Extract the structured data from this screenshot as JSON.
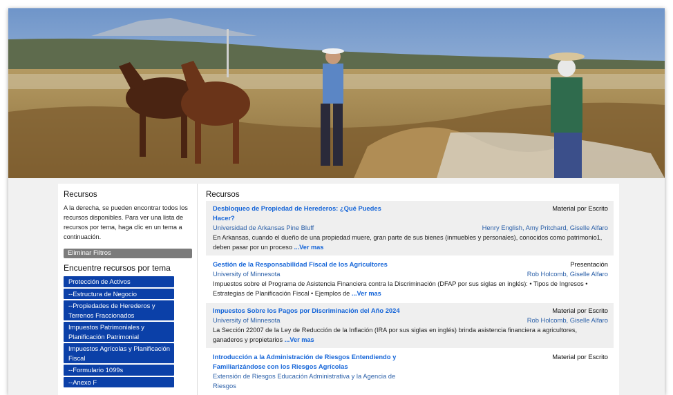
{
  "sidebar": {
    "title": "Recursos",
    "description": "A la derecha, se pueden encontrar todos los recursos disponibles. Para ver una lista de recursos por tema, haga clic en un tema a continuación.",
    "clear_filters_label": "Eliminar Filtros",
    "topics_title": "Encuentre recursos por tema",
    "topics": [
      "Protección de Activos",
      "--Estructura de Negocio",
      "--Propiedades de Herederos y Terrenos Fraccionados",
      "Impuestos Patrimoniales y Planificación Patrimonial",
      "Impuestos Agrícolas y Planificación Fiscal",
      "--Formulario 1099s",
      "--Anexo F"
    ]
  },
  "main": {
    "title": "Recursos",
    "more_label": "...Ver mas",
    "resources": [
      {
        "title": "Desbloqueo de Propiedad de Herederos: ¿Qué Puedes Hacer?",
        "type": "Material por Escrito",
        "institution": "Universidad de Arkansas Pine Bluff",
        "authors": "Henry English, Amy Pritchard, Giselle Alfaro",
        "description": "En Arkansas, cuando el dueño de una propiedad muere, gran parte de sus bienes (inmuebles y personales), conocidos como patrimonio1, deben pasar por un proceso"
      },
      {
        "title": "Gestión de la Responsabilidad Fiscal de los Agricultores",
        "type": "Presentación",
        "institution": "University of Minnesota",
        "authors": "Rob Holcomb, Giselle Alfaro",
        "description": "Impuestos sobre el Programa de Asistencia Financiera contra la Discriminación (DFAP por sus siglas en inglés): • Tipos de Ingresos • Estrategias de Planificación Fiscal • Ejemplos de"
      },
      {
        "title": "Impuestos Sobre los Pagos por Discriminación del Año 2024",
        "type": "Material por Escrito",
        "institution": "University of Minnesota",
        "authors": "Rob Holcomb, Giselle Alfaro",
        "description": "La Sección 22007 de la Ley de Reducción de la Inflación (IRA por sus siglas en inglés) brinda asistencia financiera a agricultores, ganaderos y propietarios"
      },
      {
        "title": "Introducción a la Administración de Riesgos Entendiendo y Familiarizándose con los Riesgos Agrícolas",
        "type": "Material por Escrito",
        "institution": "Extensión de Riesgos Educación Administrativa y la Agencia de Riesgos",
        "authors": "",
        "description": ""
      }
    ]
  }
}
